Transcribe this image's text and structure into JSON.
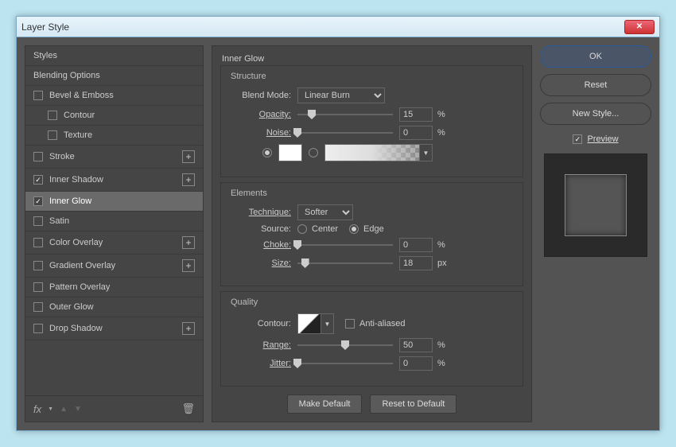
{
  "window": {
    "title": "Layer Style"
  },
  "sidebar": {
    "styles_header": "Styles",
    "blending_options": "Blending Options",
    "items": [
      {
        "label": "Bevel & Emboss",
        "checked": false,
        "plus": false
      },
      {
        "label": "Contour",
        "checked": false,
        "indent": true
      },
      {
        "label": "Texture",
        "checked": false,
        "indent": true
      },
      {
        "label": "Stroke",
        "checked": false,
        "plus": true
      },
      {
        "label": "Inner Shadow",
        "checked": true,
        "plus": true
      },
      {
        "label": "Inner Glow",
        "checked": true,
        "selected": true
      },
      {
        "label": "Satin",
        "checked": false
      },
      {
        "label": "Color Overlay",
        "checked": false,
        "plus": true
      },
      {
        "label": "Gradient Overlay",
        "checked": false,
        "plus": true
      },
      {
        "label": "Pattern Overlay",
        "checked": false
      },
      {
        "label": "Outer Glow",
        "checked": false
      },
      {
        "label": "Drop Shadow",
        "checked": false,
        "plus": true
      }
    ],
    "fx": "fx"
  },
  "panel": {
    "title": "Inner Glow",
    "structure": {
      "label": "Structure",
      "blend_mode_label": "Blend Mode:",
      "blend_mode_value": "Linear Burn",
      "opacity_label": "Opacity:",
      "opacity_value": "15",
      "opacity_unit": "%",
      "noise_label": "Noise:",
      "noise_value": "0",
      "noise_unit": "%"
    },
    "elements": {
      "label": "Elements",
      "technique_label": "Technique:",
      "technique_value": "Softer",
      "source_label": "Source:",
      "source_center": "Center",
      "source_edge": "Edge",
      "source_selected": "edge",
      "choke_label": "Choke:",
      "choke_value": "0",
      "choke_unit": "%",
      "size_label": "Size:",
      "size_value": "18",
      "size_unit": "px"
    },
    "quality": {
      "label": "Quality",
      "contour_label": "Contour:",
      "antialiased_label": "Anti-aliased",
      "range_label": "Range:",
      "range_value": "50",
      "range_unit": "%",
      "jitter_label": "Jitter:",
      "jitter_value": "0",
      "jitter_unit": "%"
    },
    "buttons": {
      "make_default": "Make Default",
      "reset_default": "Reset to Default"
    }
  },
  "right": {
    "ok": "OK",
    "reset": "Reset",
    "new_style": "New Style...",
    "preview": "Preview"
  }
}
